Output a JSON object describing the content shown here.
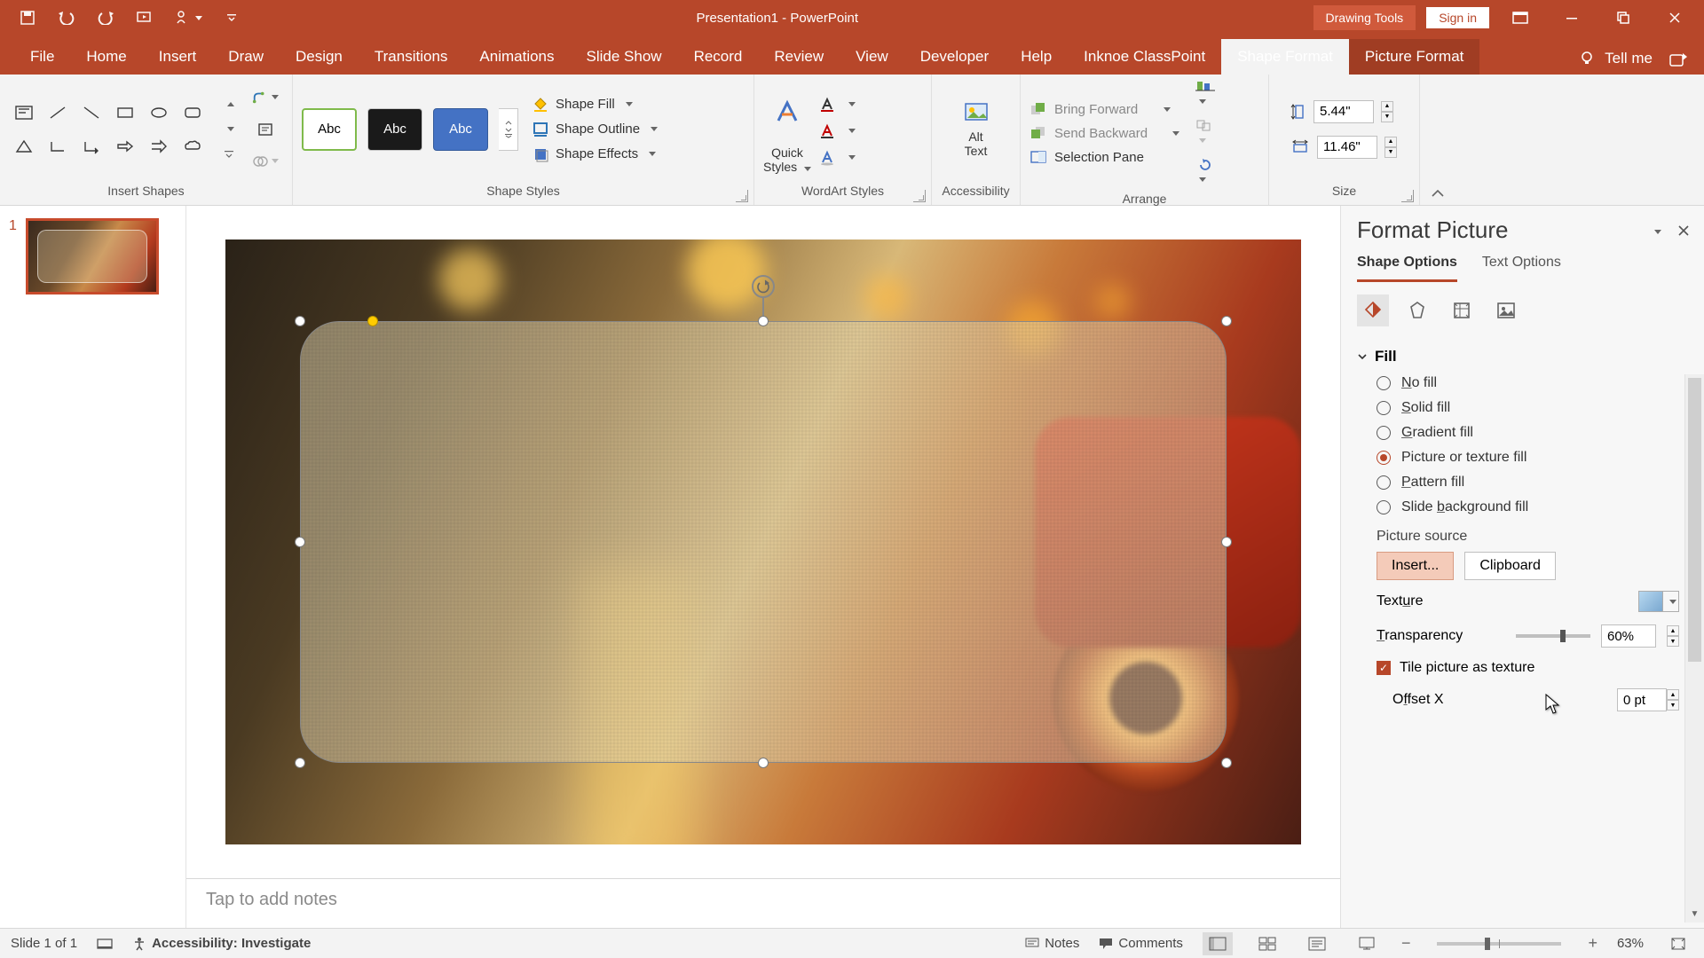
{
  "titlebar": {
    "title": "Presentation1 - PowerPoint",
    "tool_tab": "Drawing Tools",
    "signin": "Sign in"
  },
  "ribbon_tabs": {
    "file": "File",
    "home": "Home",
    "insert": "Insert",
    "draw": "Draw",
    "design": "Design",
    "transitions": "Transitions",
    "animations": "Animations",
    "slideshow": "Slide Show",
    "record": "Record",
    "review": "Review",
    "view": "View",
    "developer": "Developer",
    "help": "Help",
    "classpoint": "Inknoe ClassPoint",
    "shape_format": "Shape Format",
    "picture_format": "Picture Format",
    "tellme": "Tell me"
  },
  "ribbon": {
    "insert_shapes": "Insert Shapes",
    "shape_styles": "Shape Styles",
    "style_label": "Abc",
    "fill": "Shape Fill",
    "outline": "Shape Outline",
    "effects": "Shape Effects",
    "quick_styles_1": "Quick",
    "quick_styles_2": "Styles",
    "wordart": "WordArt Styles",
    "alt_text_1": "Alt",
    "alt_text_2": "Text",
    "accessibility": "Accessibility",
    "bring_forward": "Bring Forward",
    "send_backward": "Send Backward",
    "selection_pane": "Selection Pane",
    "arrange": "Arrange",
    "size": "Size",
    "height": "5.44\"",
    "width": "11.46\""
  },
  "thumb": {
    "num": "1"
  },
  "notes_placeholder": "Tap to add notes",
  "pane": {
    "title": "Format Picture",
    "shape_options": "Shape Options",
    "text_options": "Text Options",
    "fill_section": "Fill",
    "opts": {
      "no_fill_pre": "",
      "no_fill_u": "N",
      "no_fill_post": "o fill",
      "solid_pre": "",
      "solid_u": "S",
      "solid_post": "olid fill",
      "grad_pre": "",
      "grad_u": "G",
      "grad_post": "radient fill",
      "pic": "Picture or texture fill",
      "pat_pre": "",
      "pat_u": "P",
      "pat_post": "attern fill",
      "bg_pre": "Slide ",
      "bg_u": "b",
      "bg_post": "ackground fill"
    },
    "picture_source": "Picture source",
    "insert_btn": "Insert...",
    "clipboard_btn": "Clipboard",
    "texture_pre": "Text",
    "texture_u": "u",
    "texture_post": "re",
    "transparency_u": "T",
    "transparency_post": "ransparency",
    "transparency_val": "60%",
    "tile": "Tile picture as texture",
    "offsetx_pre": "O",
    "offsetx_u": "f",
    "offsetx_post": "fset X",
    "offsetx_val": "0 pt"
  },
  "status": {
    "slide": "Slide 1 of 1",
    "accessibility": "Accessibility: Investigate",
    "notes": "Notes",
    "comments": "Comments",
    "zoom": "63%"
  }
}
